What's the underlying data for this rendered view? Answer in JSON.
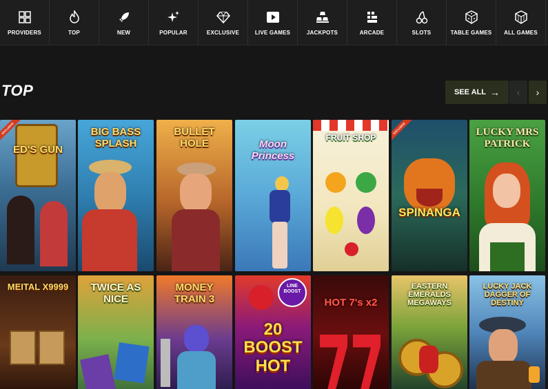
{
  "nav": [
    {
      "label": "PROVIDERS",
      "icon": "providers-icon"
    },
    {
      "label": "TOP",
      "icon": "flame-icon"
    },
    {
      "label": "NEW",
      "icon": "rocket-icon"
    },
    {
      "label": "POPULAR",
      "icon": "sparkles-icon"
    },
    {
      "label": "EXCLUSIVE",
      "icon": "diamond-icon"
    },
    {
      "label": "LIVE GAMES",
      "icon": "play-icon"
    },
    {
      "label": "JACKPOTS",
      "icon": "gold-bars-icon"
    },
    {
      "label": "ARCADE",
      "icon": "arcade-icon"
    },
    {
      "label": "SLOTS",
      "icon": "cherries-icon"
    },
    {
      "label": "TABLE GAMES",
      "icon": "dice-icon"
    },
    {
      "label": "ALL GAMES",
      "icon": "cube-icon"
    }
  ],
  "section": {
    "title": "TOP",
    "see_all": "SEE ALL",
    "see_all_arrow": "→",
    "prev": "‹",
    "next": "›"
  },
  "games": [
    {
      "name": "ED'S GUN",
      "tag": "EXCLUSIVE"
    },
    {
      "name": "BIG BASS SPLASH"
    },
    {
      "name": "BULLET HOLE"
    },
    {
      "name": "Moon Princess"
    },
    {
      "name": "FRUIT SHOP"
    },
    {
      "name": "SPINANGA",
      "tag": "EXCLUSIVE"
    },
    {
      "name": "LUCKY MRS PATRICK"
    },
    {
      "name": "MEITAL X9999"
    },
    {
      "name": "TWICE AS NICE"
    },
    {
      "name": "MONEY TRAIN 3"
    },
    {
      "name": "20 BOOST HOT",
      "badge": "LINE BOOST"
    },
    {
      "name": "HOT 7's x2"
    },
    {
      "name": "EASTERN EMERALDS MEGAWAYS"
    },
    {
      "name": "LUCKY JACK DAGGER OF DESTINY"
    }
  ]
}
